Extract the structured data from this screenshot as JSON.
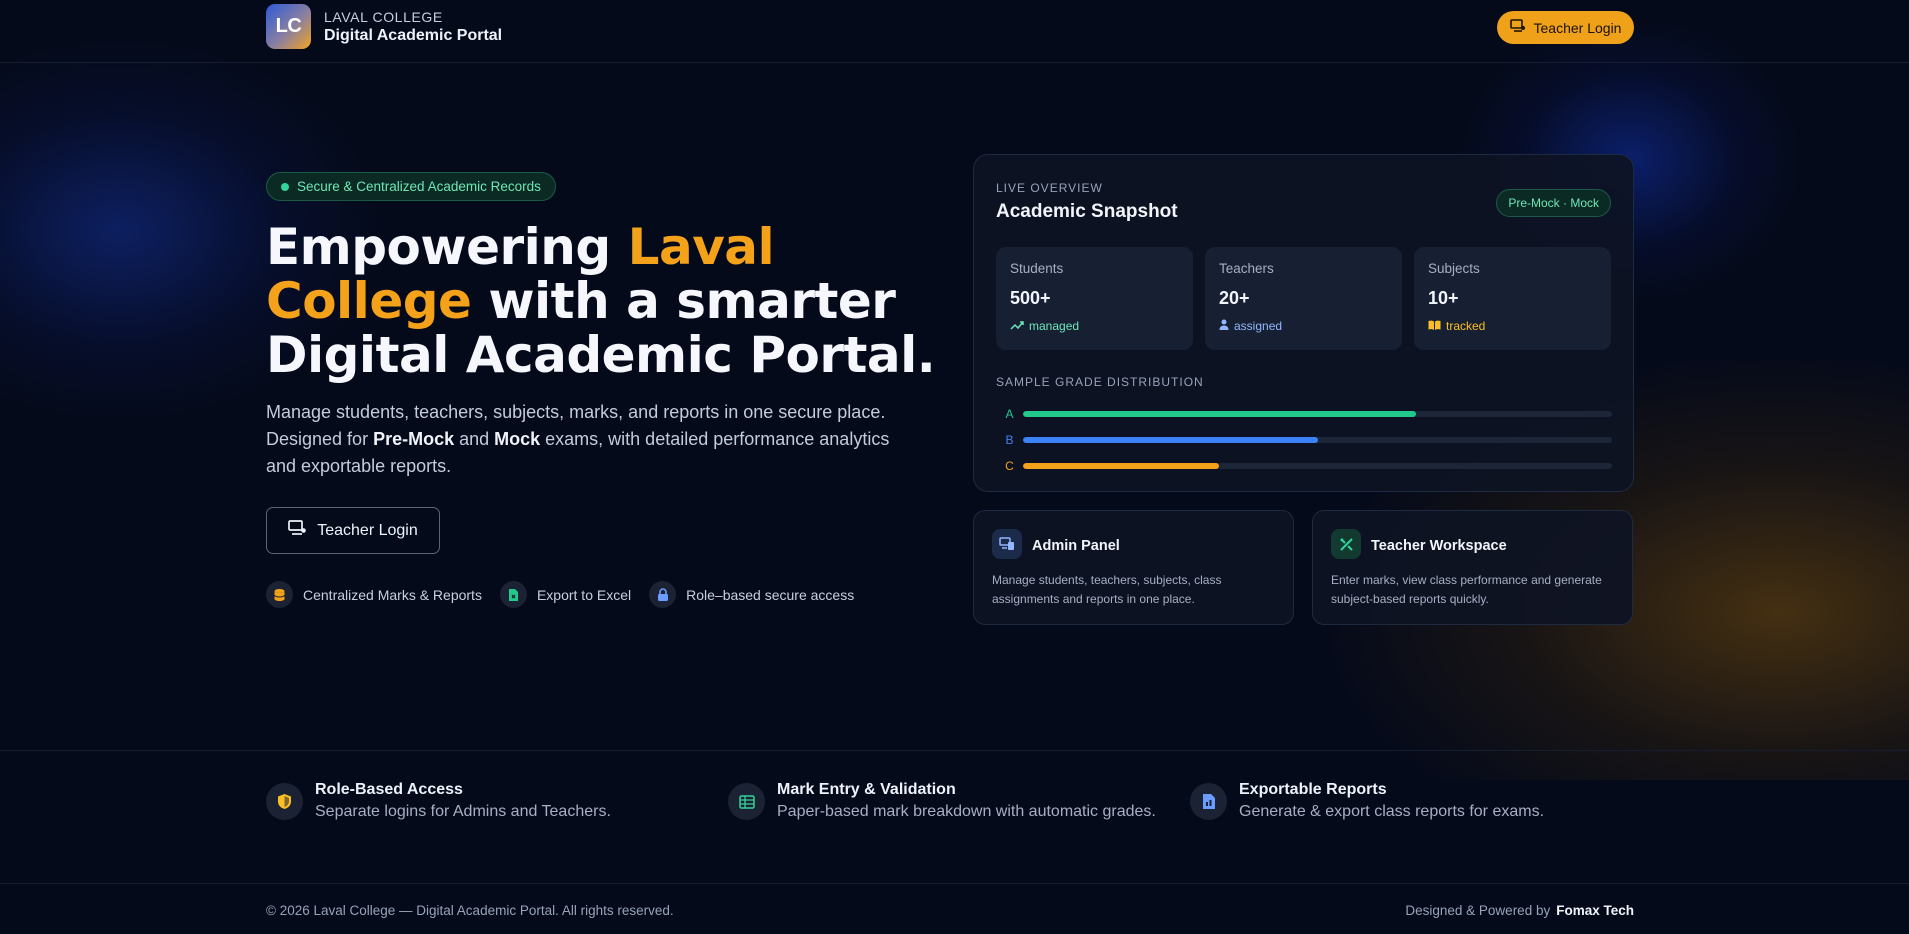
{
  "header": {
    "logo_text": "LC",
    "brand_top": "LAVAL COLLEGE",
    "brand_bottom": "Digital Academic Portal",
    "login_label": "Teacher Login"
  },
  "hero": {
    "badge": "Secure & Centralized Academic Records",
    "title_part1": "Empowering ",
    "title_accent": "Laval College",
    "title_part2": " with a smarter Digital Academic Portal.",
    "desc_part1": "Manage students, teachers, subjects, marks, and reports in one secure place. Designed for ",
    "desc_bold1": "Pre-Mock",
    "desc_mid": " and ",
    "desc_bold2": "Mock",
    "desc_part2": " exams, with detailed performance analytics and exportable reports.",
    "login_label": "Teacher Login",
    "features": [
      {
        "icon": "database-icon",
        "label": "Centralized Marks & Reports"
      },
      {
        "icon": "excel-file-icon",
        "label": "Export to Excel"
      },
      {
        "icon": "lock-icon",
        "label": "Role–based secure access"
      }
    ]
  },
  "snapshot": {
    "kicker": "LIVE OVERVIEW",
    "title": "Academic Snapshot",
    "badge": "Pre-Mock · Mock",
    "stats": [
      {
        "label": "Students",
        "value": "500+",
        "sub": "managed",
        "icon": "trending-up-icon",
        "color": "#6ee7b7"
      },
      {
        "label": "Teachers",
        "value": "20+",
        "sub": "assigned",
        "icon": "user-icon",
        "color": "#93b8ff"
      },
      {
        "label": "Subjects",
        "value": "10+",
        "sub": "tracked",
        "icon": "book-icon",
        "color": "#fbbf24"
      }
    ],
    "distribution_title": "SAMPLE GRADE DISTRIBUTION",
    "grades": [
      {
        "letter": "A",
        "fraction": 0.667,
        "color": "#22c98d"
      },
      {
        "letter": "B",
        "fraction": 0.5,
        "color": "#3b82f6"
      },
      {
        "letter": "C",
        "fraction": 0.333,
        "color": "#f5a21b"
      }
    ]
  },
  "panels": [
    {
      "title": "Admin Panel",
      "desc": "Manage students, teachers, subjects, class assignments and reports in one place.",
      "icon": "devices-icon"
    },
    {
      "title": "Teacher Workspace",
      "desc": "Enter marks, view class performance and generate subject-based reports quickly.",
      "icon": "edit-tools-icon"
    }
  ],
  "band": [
    {
      "title": "Role-Based Access",
      "desc": "Separate logins for Admins and Teachers.",
      "icon": "shield-icon"
    },
    {
      "title": "Mark Entry & Validation",
      "desc": "Paper-based mark breakdown with automatic grades.",
      "icon": "table-icon"
    },
    {
      "title": "Exportable Reports",
      "desc": "Generate & export class reports for exams.",
      "icon": "file-chart-icon"
    }
  ],
  "footer": {
    "copyright": "© 2026 Laval College — Digital Academic Portal. All rights reserved.",
    "powered_prefix": "Designed & Powered by",
    "powered_by": "Fomax Tech"
  },
  "colors": {
    "accent": "#f5a21b",
    "background": "#050a1a",
    "success": "#34d399"
  }
}
